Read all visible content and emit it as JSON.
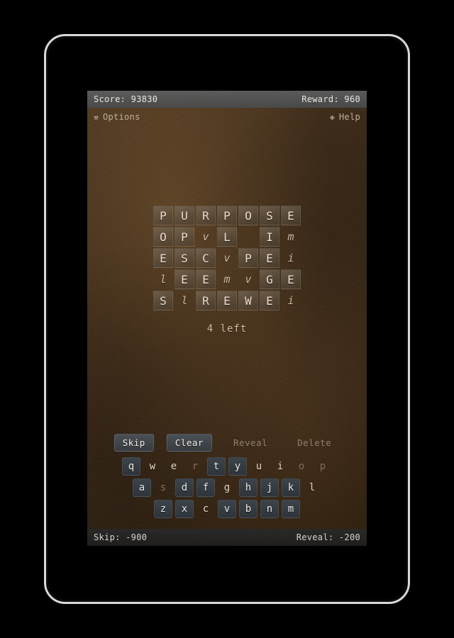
{
  "status_bar": {
    "score_label": "Score: 93830",
    "reward_label": "Reward: 960"
  },
  "menu_bar": {
    "options_label": "Options",
    "options_icon": "crossed-tools-icon",
    "options_glyph": "⚒",
    "help_label": "Help",
    "help_icon": "snowflake-icon",
    "help_glyph": "❉"
  },
  "grid": {
    "rows": [
      [
        {
          "letter": "P",
          "state": "tile"
        },
        {
          "letter": "U",
          "state": "tile"
        },
        {
          "letter": "R",
          "state": "tile"
        },
        {
          "letter": "P",
          "state": "tile"
        },
        {
          "letter": "O",
          "state": "tile"
        },
        {
          "letter": "S",
          "state": "tile"
        },
        {
          "letter": "E",
          "state": "tile"
        }
      ],
      [
        {
          "letter": "O",
          "state": "tile"
        },
        {
          "letter": "P",
          "state": "tile"
        },
        {
          "letter": "v",
          "state": "ghost"
        },
        {
          "letter": "L",
          "state": "tile"
        },
        {
          "letter": "",
          "state": "empty"
        },
        {
          "letter": "I",
          "state": "tile"
        },
        {
          "letter": "m",
          "state": "ghost"
        }
      ],
      [
        {
          "letter": "E",
          "state": "tile"
        },
        {
          "letter": "S",
          "state": "tile"
        },
        {
          "letter": "C",
          "state": "tile"
        },
        {
          "letter": "v",
          "state": "ghost"
        },
        {
          "letter": "P",
          "state": "tile"
        },
        {
          "letter": "E",
          "state": "tile"
        },
        {
          "letter": "i",
          "state": "ghost"
        }
      ],
      [
        {
          "letter": "l",
          "state": "ghost"
        },
        {
          "letter": "E",
          "state": "tile"
        },
        {
          "letter": "E",
          "state": "tile"
        },
        {
          "letter": "m",
          "state": "ghost"
        },
        {
          "letter": "v",
          "state": "ghost"
        },
        {
          "letter": "G",
          "state": "tile"
        },
        {
          "letter": "E",
          "state": "tile"
        }
      ],
      [
        {
          "letter": "S",
          "state": "tile"
        },
        {
          "letter": "l",
          "state": "ghost"
        },
        {
          "letter": "R",
          "state": "tile"
        },
        {
          "letter": "E",
          "state": "tile"
        },
        {
          "letter": "W",
          "state": "tile"
        },
        {
          "letter": "E",
          "state": "tile"
        },
        {
          "letter": "i",
          "state": "ghost"
        }
      ]
    ]
  },
  "remaining_label": "4 left",
  "actions": [
    {
      "label": "Skip",
      "state": "enabled"
    },
    {
      "label": "Clear",
      "state": "enabled"
    },
    {
      "label": "Reveal",
      "state": "disabled"
    },
    {
      "label": "Delete",
      "state": "disabled"
    }
  ],
  "keyboard": {
    "rows": [
      [
        {
          "key": "q",
          "state": "available"
        },
        {
          "key": "w",
          "state": "plain"
        },
        {
          "key": "e",
          "state": "plain"
        },
        {
          "key": "r",
          "state": "dim"
        },
        {
          "key": "t",
          "state": "available"
        },
        {
          "key": "y",
          "state": "available"
        },
        {
          "key": "u",
          "state": "plain"
        },
        {
          "key": "i",
          "state": "plain"
        },
        {
          "key": "o",
          "state": "dim"
        },
        {
          "key": "p",
          "state": "dim"
        }
      ],
      [
        {
          "key": "a",
          "state": "available"
        },
        {
          "key": "s",
          "state": "dim"
        },
        {
          "key": "d",
          "state": "available"
        },
        {
          "key": "f",
          "state": "available"
        },
        {
          "key": "g",
          "state": "plain"
        },
        {
          "key": "h",
          "state": "available"
        },
        {
          "key": "j",
          "state": "available"
        },
        {
          "key": "k",
          "state": "available"
        },
        {
          "key": "l",
          "state": "plain"
        }
      ],
      [
        {
          "key": "z",
          "state": "available"
        },
        {
          "key": "x",
          "state": "available"
        },
        {
          "key": "c",
          "state": "plain"
        },
        {
          "key": "v",
          "state": "available"
        },
        {
          "key": "b",
          "state": "available"
        },
        {
          "key": "n",
          "state": "available"
        },
        {
          "key": "m",
          "state": "available"
        }
      ]
    ]
  },
  "bottom_bar": {
    "skip_cost_label": "Skip: -900",
    "reveal_cost_label": "Reveal: -200"
  },
  "colors": {
    "screen_brown": "#3b2a19",
    "tile_face": "#80746 4",
    "tile_text": "#f0ddcd",
    "status_bar_gray": "#5c6062",
    "key_slate": "#3c434a",
    "bottom_bar_dark": "#2a2a2a"
  }
}
